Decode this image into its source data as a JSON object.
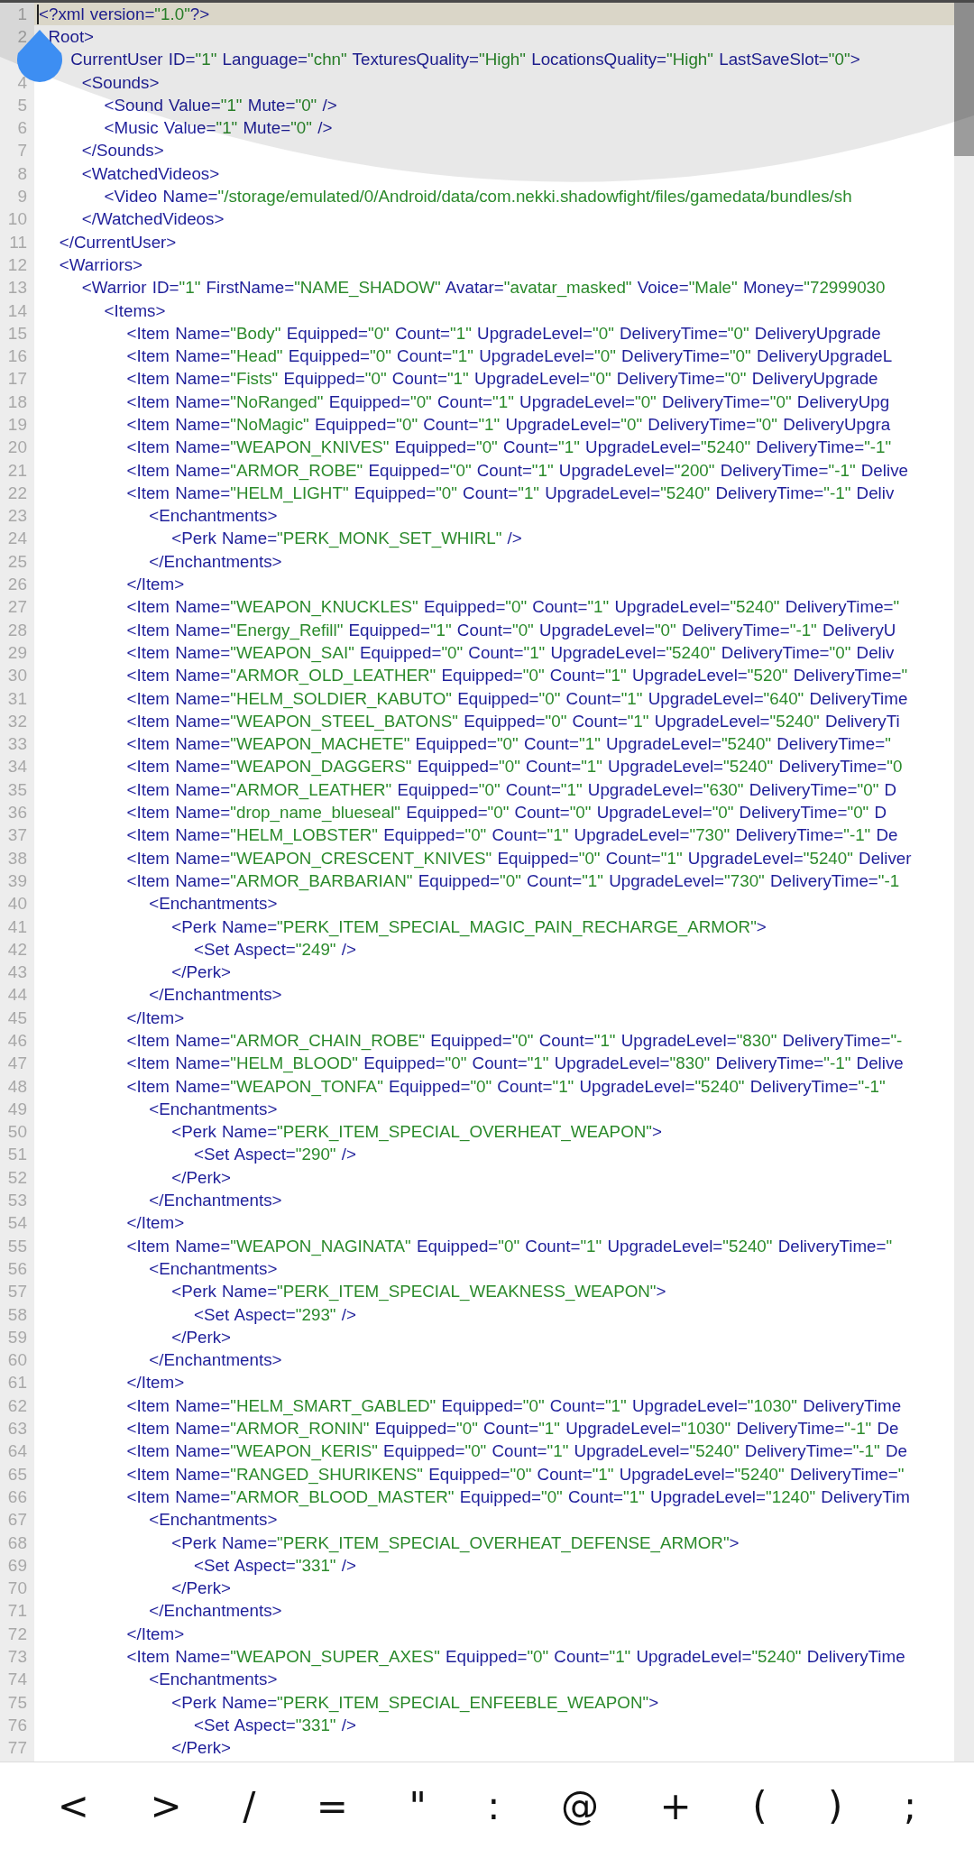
{
  "editor": {
    "lines": [
      {
        "number": "1",
        "text": "<?xml version=\"1.0\"?>",
        "current": true
      },
      {
        "number": "2",
        "text": "  Root>",
        "current": false
      },
      {
        "text": "      CurrentUser ID=\"1\" Language=\"chn\" TexturesQuality=\"High\" LocationsQuality=\"High\" LastSaveSlot=\"0\">",
        "current": false
      },
      {
        "number": "4",
        "text": "        <Sounds>",
        "current": false
      },
      {
        "number": "5",
        "text": "            <Sound Value=\"1\" Mute=\"0\" />",
        "current": false
      },
      {
        "number": "6",
        "text": "            <Music Value=\"1\" Mute=\"0\" />",
        "current": false
      },
      {
        "number": "7",
        "text": "        </Sounds>",
        "current": false
      },
      {
        "number": "8",
        "text": "        <WatchedVideos>",
        "current": false
      },
      {
        "number": "9",
        "text": "            <Video Name=\"/storage/emulated/0/Android/data/com.nekki.shadowfight/files/gamedata/bundles/sh",
        "current": false
      },
      {
        "number": "10",
        "text": "        </WatchedVideos>",
        "current": false
      },
      {
        "number": "11",
        "text": "    </CurrentUser>",
        "current": false
      },
      {
        "number": "12",
        "text": "    <Warriors>",
        "current": false
      },
      {
        "number": "13",
        "text": "        <Warrior ID=\"1\" FirstName=\"NAME_SHADOW\" Avatar=\"avatar_masked\" Voice=\"Male\" Money=\"72999030",
        "current": false
      },
      {
        "number": "14",
        "text": "            <Items>",
        "current": false
      },
      {
        "number": "15",
        "text": "                <Item Name=\"Body\" Equipped=\"0\" Count=\"1\" UpgradeLevel=\"0\" DeliveryTime=\"0\" DeliveryUpgrade",
        "current": false
      },
      {
        "number": "16",
        "text": "                <Item Name=\"Head\" Equipped=\"0\" Count=\"1\" UpgradeLevel=\"0\" DeliveryTime=\"0\" DeliveryUpgradeL",
        "current": false
      },
      {
        "number": "17",
        "text": "                <Item Name=\"Fists\" Equipped=\"0\" Count=\"1\" UpgradeLevel=\"0\" DeliveryTime=\"0\" DeliveryUpgrade",
        "current": false
      },
      {
        "number": "18",
        "text": "                <Item Name=\"NoRanged\" Equipped=\"0\" Count=\"1\" UpgradeLevel=\"0\" DeliveryTime=\"0\" DeliveryUpg",
        "current": false
      },
      {
        "number": "19",
        "text": "                <Item Name=\"NoMagic\" Equipped=\"0\" Count=\"1\" UpgradeLevel=\"0\" DeliveryTime=\"0\" DeliveryUpgra",
        "current": false
      },
      {
        "number": "20",
        "text": "                <Item Name=\"WEAPON_KNIVES\" Equipped=\"0\" Count=\"1\" UpgradeLevel=\"5240\" DeliveryTime=\"-1\"",
        "current": false
      },
      {
        "number": "21",
        "text": "                <Item Name=\"ARMOR_ROBE\" Equipped=\"0\" Count=\"1\" UpgradeLevel=\"200\" DeliveryTime=\"-1\" Delive",
        "current": false
      },
      {
        "number": "22",
        "text": "                <Item Name=\"HELM_LIGHT\" Equipped=\"0\" Count=\"1\" UpgradeLevel=\"5240\" DeliveryTime=\"-1\" Deliv",
        "current": false
      },
      {
        "number": "23",
        "text": "                    <Enchantments>",
        "current": false
      },
      {
        "number": "24",
        "text": "                        <Perk Name=\"PERK_MONK_SET_WHIRL\" />",
        "current": false
      },
      {
        "number": "25",
        "text": "                    </Enchantments>",
        "current": false
      },
      {
        "number": "26",
        "text": "                </Item>",
        "current": false
      },
      {
        "number": "27",
        "text": "                <Item Name=\"WEAPON_KNUCKLES\" Equipped=\"0\" Count=\"1\" UpgradeLevel=\"5240\" DeliveryTime=\"",
        "current": false
      },
      {
        "number": "28",
        "text": "                <Item Name=\"Energy_Refill\" Equipped=\"1\" Count=\"0\" UpgradeLevel=\"0\" DeliveryTime=\"-1\" DeliveryU",
        "current": false
      },
      {
        "number": "29",
        "text": "                <Item Name=\"WEAPON_SAI\" Equipped=\"0\" Count=\"1\" UpgradeLevel=\"5240\" DeliveryTime=\"0\" Deliv",
        "current": false
      },
      {
        "number": "30",
        "text": "                <Item Name=\"ARMOR_OLD_LEATHER\" Equipped=\"0\" Count=\"1\" UpgradeLevel=\"520\" DeliveryTime=\"",
        "current": false
      },
      {
        "number": "31",
        "text": "                <Item Name=\"HELM_SOLDIER_KABUTO\" Equipped=\"0\" Count=\"1\" UpgradeLevel=\"640\" DeliveryTime",
        "current": false
      },
      {
        "number": "32",
        "text": "                <Item Name=\"WEAPON_STEEL_BATONS\" Equipped=\"0\" Count=\"1\" UpgradeLevel=\"5240\" DeliveryTi",
        "current": false
      },
      {
        "number": "33",
        "text": "                <Item Name=\"WEAPON_MACHETE\" Equipped=\"0\" Count=\"1\" UpgradeLevel=\"5240\" DeliveryTime=\"",
        "current": false
      },
      {
        "number": "34",
        "text": "                <Item Name=\"WEAPON_DAGGERS\" Equipped=\"0\" Count=\"1\" UpgradeLevel=\"5240\" DeliveryTime=\"0",
        "current": false
      },
      {
        "number": "35",
        "text": "                <Item Name=\"ARMOR_LEATHER\" Equipped=\"0\" Count=\"1\" UpgradeLevel=\"630\" DeliveryTime=\"0\" D",
        "current": false
      },
      {
        "number": "36",
        "text": "                <Item Name=\"drop_name_blueseal\" Equipped=\"0\" Count=\"0\" UpgradeLevel=\"0\" DeliveryTime=\"0\" D",
        "current": false
      },
      {
        "number": "37",
        "text": "                <Item Name=\"HELM_LOBSTER\" Equipped=\"0\" Count=\"1\" UpgradeLevel=\"730\" DeliveryTime=\"-1\" De",
        "current": false
      },
      {
        "number": "38",
        "text": "                <Item Name=\"WEAPON_CRESCENT_KNIVES\" Equipped=\"0\" Count=\"1\" UpgradeLevel=\"5240\" Deliver",
        "current": false
      },
      {
        "number": "39",
        "text": "                <Item Name=\"ARMOR_BARBARIAN\" Equipped=\"0\" Count=\"1\" UpgradeLevel=\"730\" DeliveryTime=\"-1",
        "current": false
      },
      {
        "number": "40",
        "text": "                    <Enchantments>",
        "current": false
      },
      {
        "number": "41",
        "text": "                        <Perk Name=\"PERK_ITEM_SPECIAL_MAGIC_PAIN_RECHARGE_ARMOR\">",
        "current": false
      },
      {
        "number": "42",
        "text": "                            <Set Aspect=\"249\" />",
        "current": false
      },
      {
        "number": "43",
        "text": "                        </Perk>",
        "current": false
      },
      {
        "number": "44",
        "text": "                    </Enchantments>",
        "current": false
      },
      {
        "number": "45",
        "text": "                </Item>",
        "current": false
      },
      {
        "number": "46",
        "text": "                <Item Name=\"ARMOR_CHAIN_ROBE\" Equipped=\"0\" Count=\"1\" UpgradeLevel=\"830\" DeliveryTime=\"-",
        "current": false
      },
      {
        "number": "47",
        "text": "                <Item Name=\"HELM_BLOOD\" Equipped=\"0\" Count=\"1\" UpgradeLevel=\"830\" DeliveryTime=\"-1\" Delive",
        "current": false
      },
      {
        "number": "48",
        "text": "                <Item Name=\"WEAPON_TONFA\" Equipped=\"0\" Count=\"1\" UpgradeLevel=\"5240\" DeliveryTime=\"-1\"",
        "current": false
      },
      {
        "number": "49",
        "text": "                    <Enchantments>",
        "current": false
      },
      {
        "number": "50",
        "text": "                        <Perk Name=\"PERK_ITEM_SPECIAL_OVERHEAT_WEAPON\">",
        "current": false
      },
      {
        "number": "51",
        "text": "                            <Set Aspect=\"290\" />",
        "current": false
      },
      {
        "number": "52",
        "text": "                        </Perk>",
        "current": false
      },
      {
        "number": "53",
        "text": "                    </Enchantments>",
        "current": false
      },
      {
        "number": "54",
        "text": "                </Item>",
        "current": false
      },
      {
        "number": "55",
        "text": "                <Item Name=\"WEAPON_NAGINATA\" Equipped=\"0\" Count=\"1\" UpgradeLevel=\"5240\" DeliveryTime=\"",
        "current": false
      },
      {
        "number": "56",
        "text": "                    <Enchantments>",
        "current": false
      },
      {
        "number": "57",
        "text": "                        <Perk Name=\"PERK_ITEM_SPECIAL_WEAKNESS_WEAPON\">",
        "current": false
      },
      {
        "number": "58",
        "text": "                            <Set Aspect=\"293\" />",
        "current": false
      },
      {
        "number": "59",
        "text": "                        </Perk>",
        "current": false
      },
      {
        "number": "60",
        "text": "                    </Enchantments>",
        "current": false
      },
      {
        "number": "61",
        "text": "                </Item>",
        "current": false
      },
      {
        "number": "62",
        "text": "                <Item Name=\"HELM_SMART_GABLED\" Equipped=\"0\" Count=\"1\" UpgradeLevel=\"1030\" DeliveryTime",
        "current": false
      },
      {
        "number": "63",
        "text": "                <Item Name=\"ARMOR_RONIN\" Equipped=\"0\" Count=\"1\" UpgradeLevel=\"1030\" DeliveryTime=\"-1\" De",
        "current": false
      },
      {
        "number": "64",
        "text": "                <Item Name=\"WEAPON_KERIS\" Equipped=\"0\" Count=\"1\" UpgradeLevel=\"5240\" DeliveryTime=\"-1\" De",
        "current": false
      },
      {
        "number": "65",
        "text": "                <Item Name=\"RANGED_SHURIKENS\" Equipped=\"0\" Count=\"1\" UpgradeLevel=\"5240\" DeliveryTime=\"",
        "current": false
      },
      {
        "number": "66",
        "text": "                <Item Name=\"ARMOR_BLOOD_MASTER\" Equipped=\"0\" Count=\"1\" UpgradeLevel=\"1240\" DeliveryTim",
        "current": false
      },
      {
        "number": "67",
        "text": "                    <Enchantments>",
        "current": false
      },
      {
        "number": "68",
        "text": "                        <Perk Name=\"PERK_ITEM_SPECIAL_OVERHEAT_DEFENSE_ARMOR\">",
        "current": false
      },
      {
        "number": "69",
        "text": "                            <Set Aspect=\"331\" />",
        "current": false
      },
      {
        "number": "70",
        "text": "                        </Perk>",
        "current": false
      },
      {
        "number": "71",
        "text": "                    </Enchantments>",
        "current": false
      },
      {
        "number": "72",
        "text": "                </Item>",
        "current": false
      },
      {
        "number": "73",
        "text": "                <Item Name=\"WEAPON_SUPER_AXES\" Equipped=\"0\" Count=\"1\" UpgradeLevel=\"5240\" DeliveryTime",
        "current": false
      },
      {
        "number": "74",
        "text": "                    <Enchantments>",
        "current": false
      },
      {
        "number": "75",
        "text": "                        <Perk Name=\"PERK_ITEM_SPECIAL_ENFEEBLE_WEAPON\">",
        "current": false
      },
      {
        "number": "76",
        "text": "                            <Set Aspect=\"331\" />",
        "current": false
      },
      {
        "number": "77",
        "text": "                        </Perk>",
        "current": false
      }
    ]
  },
  "symbol_keys": [
    "<",
    ">",
    "/",
    "=",
    "\"",
    ":",
    "@",
    "+",
    "(",
    ")",
    ";"
  ]
}
